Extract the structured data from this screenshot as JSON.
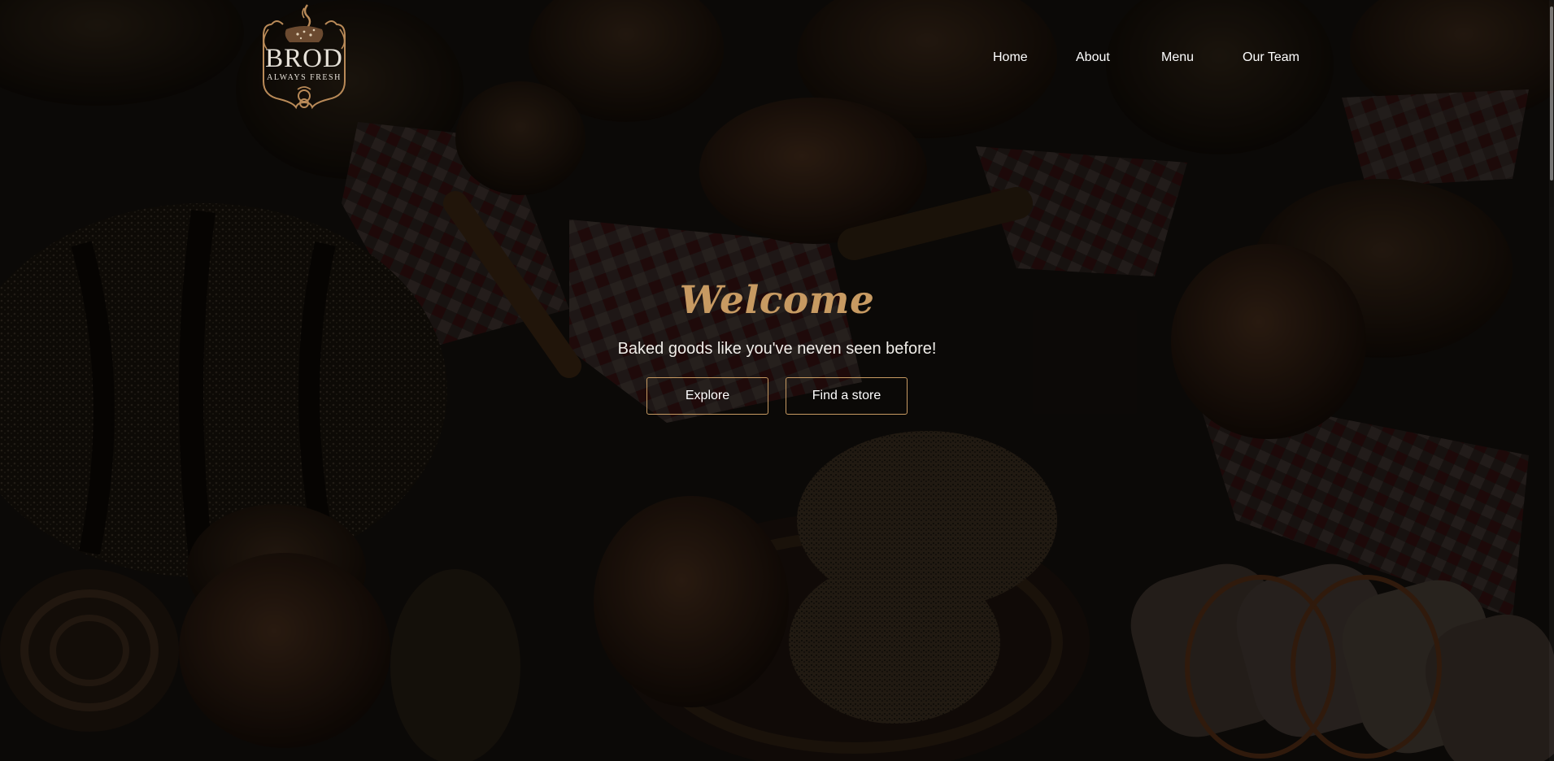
{
  "brand": {
    "name": "BROD",
    "tagline": "ALWAYS FRESH"
  },
  "nav": {
    "items": [
      {
        "label": "Home"
      },
      {
        "label": "About"
      },
      {
        "label": "Menu"
      },
      {
        "label": "Our Team"
      }
    ]
  },
  "hero": {
    "title": "Welcome",
    "subtitle": "Baked goods like you've neven seen before!",
    "explore_label": "Explore",
    "find_store_label": "Find a store"
  },
  "colors": {
    "accent": "#c79a62",
    "text": "#ffffff",
    "background": "#0c0a08"
  },
  "icons": {
    "logo": "bread-steam-logo"
  }
}
